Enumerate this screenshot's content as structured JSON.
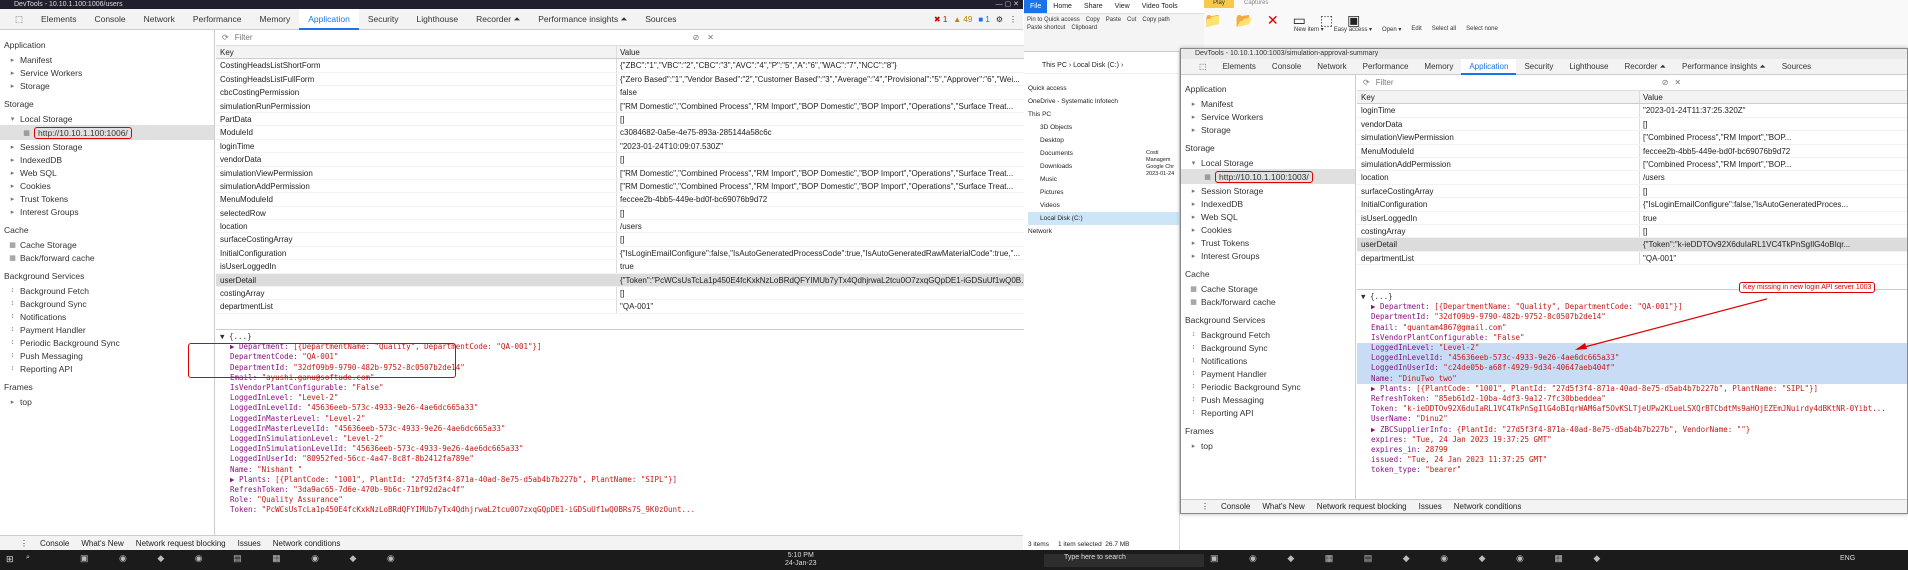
{
  "left": {
    "title": "DevTools - 10.10.1.100:1006/users",
    "tabs": [
      "Elements",
      "Console",
      "Network",
      "Performance",
      "Memory",
      "Application",
      "Security",
      "Lighthouse",
      "Recorder ⏶",
      "Performance insights ⏶",
      "Sources"
    ],
    "badges": {
      "errors": "1",
      "warnings": "49",
      "info": "1"
    },
    "filter_placeholder": "Filter",
    "sidebar": {
      "app_label": "Application",
      "app_items": [
        "Manifest",
        "Service Workers",
        "Storage"
      ],
      "storage_label": "Storage",
      "local_storage": "Local Storage",
      "local_url": "http://10.10.1.100:1006/",
      "storage_items": [
        "Session Storage",
        "IndexedDB",
        "Web SQL",
        "Cookies",
        "Trust Tokens",
        "Interest Groups"
      ],
      "cache_label": "Cache",
      "cache_items": [
        "Cache Storage",
        "Back/forward cache"
      ],
      "bg_label": "Background Services",
      "bg_items": [
        "Background Fetch",
        "Background Sync",
        "Notifications",
        "Payment Handler",
        "Periodic Background Sync",
        "Push Messaging",
        "Reporting API"
      ],
      "frames_label": "Frames",
      "frames_items": [
        "top"
      ]
    },
    "table_head": {
      "key": "Key",
      "value": "Value"
    },
    "rows": [
      {
        "k": "CostingHeadsListShortForm",
        "v": "{\"ZBC\":\"1\",\"VBC\":\"2\",\"CBC\":\"3\",\"AVC\":\"4\",\"P\":\"5\",\"A\":\"6\",\"WAC\":\"7\",\"NCC\":\"8\"}"
      },
      {
        "k": "CostingHeadsListFullForm",
        "v": "{\"Zero Based\":\"1\",\"Vendor Based\":\"2\",\"Customer Based\":\"3\",\"Average\":\"4\",\"Provisional\":\"5\",\"Approver\":\"6\",\"Wei..."
      },
      {
        "k": "cbcCostingPermission",
        "v": "false"
      },
      {
        "k": "simulationRunPermission",
        "v": "[\"RM Domestic\",\"Combined Process\",\"RM Import\",\"BOP Domestic\",\"BOP Import\",\"Operations\",\"Surface Treat..."
      },
      {
        "k": "PartData",
        "v": "[]"
      },
      {
        "k": "ModuleId",
        "v": "c3084682-0a5e-4e75-893a-285144a58c6c"
      },
      {
        "k": "loginTime",
        "v": "\"2023-01-24T10:09:07.530Z\""
      },
      {
        "k": "vendorData",
        "v": "[]"
      },
      {
        "k": "simulationViewPermission",
        "v": "[\"RM Domestic\",\"Combined Process\",\"RM Import\",\"BOP Domestic\",\"BOP Import\",\"Operations\",\"Surface Treat..."
      },
      {
        "k": "simulationAddPermission",
        "v": "[\"RM Domestic\",\"Combined Process\",\"RM Import\",\"BOP Domestic\",\"BOP Import\",\"Operations\",\"Surface Treat..."
      },
      {
        "k": "MenuModuleId",
        "v": "feccee2b-4bb5-449e-bd0f-bc69076b9d72"
      },
      {
        "k": "selectedRow",
        "v": "[]"
      },
      {
        "k": "location",
        "v": "/users"
      },
      {
        "k": "surfaceCostingArray",
        "v": "[]"
      },
      {
        "k": "InitialConfiguration",
        "v": "{\"IsLoginEmailConfigure\":false,\"IsAutoGeneratedProcessCode\":true,\"IsAutoGeneratedRawMaterialCode\":true,\"..."
      },
      {
        "k": "isUserLoggedIn",
        "v": "true"
      },
      {
        "k": "userDetail",
        "v": "{\"Token\":\"PcWCsUsTcLa1p450E4fcKxkNzLoBRdQFYIMUb7yTx4QdhjrwaL2tcu0O7zxqGQpDE1-iGDSuUf1wQ0B..."
      },
      {
        "k": "costingArray",
        "v": "[]"
      },
      {
        "k": "departmentList",
        "v": "\"QA-001\""
      }
    ],
    "json": [
      "▼ {...}",
      "▶ Department: [{DepartmentName: \"Quality\", DepartmentCode: \"QA-001\"}]",
      "DepartmentCode: \"QA-001\"",
      "DepartmentId: \"32df09b9-9790-482b-9752-8c0507b2de14\"",
      "Email: \"ayushi.ganu@softude.com\"",
      "IsVendorPlantConfigurable: \"False\"",
      "LoggedInLevel: \"Level-2\"",
      "LoggedInLevelId: \"45636eeb-573c-4933-9e26-4ae6dc665a33\"",
      "LoggedInMasterLevel: \"Level-2\"",
      "LoggedInMasterLevelId: \"45636eeb-573c-4933-9e26-4ae6dc665a33\"",
      "LoggedInSimulationLevel: \"Level-2\"",
      "LoggedInSimulationLevelId: \"45636eeb-573c-4933-9e26-4ae6dc665a33\"",
      "LoggedInUserId: \"80952fed-56cc-4a47-8c8f-8b2412fa789e\"",
      "Name: \"Nishant \"",
      "▶ Plants: [{PlantCode: \"1001\", PlantId: \"27d5f3f4-871a-40ad-8e75-d5ab4b7b227b\", PlantName: \"SIPL\"}]",
      "RefreshToken: \"3da9ac65-7d6e-470b-9b6c-71bf92d2ac4f\"",
      "Role: \"Quality Assurance\"",
      "Token: \"PcWCsUsTcLa1p450E4fcKxkNzLoBRdQFYIMUb7yTx4QdhjrwaL2tcu0O7zxqGQpDE1-iGDSuUf1wQ0BRs7S_9K0zOunt..."
    ],
    "drawer": [
      "Console",
      "What's New",
      "Network request blocking",
      "Issues",
      "Network conditions"
    ]
  },
  "right": {
    "ribbon_tabs": [
      "File",
      "Home",
      "Share",
      "View",
      "Video Tools"
    ],
    "play": "Play",
    "captures": "Captures",
    "ribbon_labels": [
      "Pin to Quick access",
      "Copy",
      "Paste",
      "Cut",
      "Copy path",
      "Paste shortcut",
      "Clipboard",
      "New item ▾",
      "Easy access ▾",
      "Open ▾",
      "Edit",
      "Select all",
      "Select none"
    ],
    "path": "This PC  ›  Local Disk (C:)  ›",
    "nav": [
      "Quick access",
      "OneDrive - Systematic Infotech",
      "This PC",
      "3D Objects",
      "Desktop",
      "Documents",
      "Downloads",
      "Music",
      "Pictures",
      "Videos",
      "Local Disk (C:)",
      "Network"
    ],
    "file_label": "Costi Managem Google Chr 2023-01-24",
    "status": "3 items     1 item selected  26.7 MB",
    "title": "DevTools - 10.10.1.100:1003/simulation-approval-summary",
    "tabs": [
      "Elements",
      "Console",
      "Network",
      "Performance",
      "Memory",
      "Application",
      "Security",
      "Lighthouse",
      "Recorder ⏶",
      "Performance insights ⏶",
      "Sources"
    ],
    "filter_placeholder": "Filter",
    "local_url": "http://10.10.1.100:1003/",
    "rows": [
      {
        "k": "loginTime",
        "v": "\"2023-01-24T11:37:25.320Z\""
      },
      {
        "k": "vendorData",
        "v": "[]"
      },
      {
        "k": "simulationViewPermission",
        "v": "[\"Combined Process\",\"RM Import\",\"BOP..."
      },
      {
        "k": "MenuModuleId",
        "v": "feccee2b-4bb5-449e-bd0f-bc69076b9d72"
      },
      {
        "k": "simulationAddPermission",
        "v": "[\"Combined Process\",\"RM Import\",\"BOP..."
      },
      {
        "k": "location",
        "v": "/users"
      },
      {
        "k": "surfaceCostingArray",
        "v": "[]"
      },
      {
        "k": "InitialConfiguration",
        "v": "{\"IsLoginEmailConfigure\":false,\"IsAutoGeneratedProces..."
      },
      {
        "k": "isUserLoggedIn",
        "v": "true"
      },
      {
        "k": "costingArray",
        "v": "[]"
      },
      {
        "k": "userDetail",
        "v": "{\"Token\":\"k-ieDDTOv92X6duIaRL1VC4TkPnSgIlG4oBIqr..."
      },
      {
        "k": "departmentList",
        "v": "\"QA-001\""
      }
    ],
    "note": "Key missing in new login API server 1003",
    "json": [
      "▼ {...}",
      "▶ Department: [{DepartmentName: \"Quality\", DepartmentCode: \"QA-001\"}]",
      "DepartmentId: \"32df09b9-9790-482b-9752-8c0507b2de14\"",
      "Email: \"quantam4867@gmail.com\"",
      "IsVendorPlantConfigurable: \"False\"",
      "LoggedInLevel: \"Level-2\"",
      "LoggedInLevelId: \"45636eeb-573c-4933-9e26-4ae6dc665a33\"",
      "LoggedInUserId: \"c24de05b-a68f-4929-9d34-40647aeb404f\"",
      "Name: \"DinuTwo two\"",
      "▶ Plants: [{PlantCode: \"1001\", PlantId: \"27d5f3f4-871a-40ad-8e75-d5ab4b7b227b\", PlantName: \"SIPL\"}]",
      "RefreshToken: \"85eb61d2-10ba-4df3-9a12-7fc30bbeddea\"",
      "Token: \"k-ieDDTOv92X6duIaRL1VC4TkPnSgIlG4oBIqrWAM6af5OvKSLTjeUPw2KLueLSXQrBTCbdtMs9aHOjEZEmJNuirdy4dBKtNR-0Yibt...",
      "UserName: \"Dinu2\"",
      "▶ ZBCSupplierInfo: {PlantId: \"27d5f3f4-871a-40ad-8e75-d5ab4b7b227b\", VendorName: \"\"}",
      "expires: \"Tue, 24 Jan 2023 19:37:25 GMT\"",
      "expires_in: 28799",
      "issued: \"Tue, 24 Jan 2023 11:37:25 GMT\"",
      "token_type: \"bearer\""
    ],
    "drawer": [
      "Console",
      "What's New",
      "Network request blocking",
      "Issues",
      "Network conditions"
    ]
  },
  "taskbar": {
    "search": "Type here to search",
    "time": "5:10 PM",
    "date": "24-Jan-23",
    "lang": "ENG"
  }
}
